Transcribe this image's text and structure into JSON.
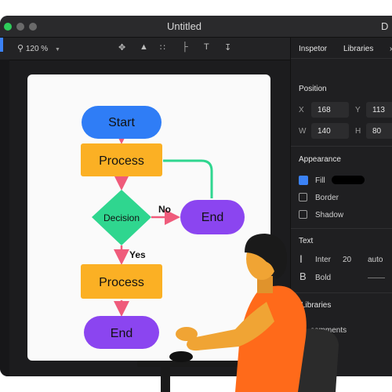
{
  "window": {
    "title": "Untitled"
  },
  "toolbar": {
    "zoom_label": "120 %"
  },
  "inspector": {
    "tabs": [
      {
        "label": "Inspetor"
      },
      {
        "label": "Libraries"
      }
    ],
    "position": {
      "title": "Position",
      "x_label": "X",
      "x_value": "168",
      "y_label": "Y",
      "y_value": "113",
      "w_label": "W",
      "w_value": "140",
      "h_label": "H",
      "h_value": "80"
    },
    "appearance": {
      "title": "Appearance",
      "fill_label": "Fill",
      "fill_color": "#3b82f6",
      "border_label": "Border",
      "shadow_label": "Shadow"
    },
    "text": {
      "title": "Text",
      "font_name": "Inter",
      "font_size": "20",
      "line_height": "auto",
      "weight": "Bold"
    },
    "libraries": {
      "title": "Libraries",
      "comments_label": "comments"
    }
  },
  "flowchart": {
    "start": "Start",
    "process1": "Process",
    "decision": "Decision",
    "end_right": "End",
    "no_label": "No",
    "yes_label": "Yes",
    "process2": "Process",
    "end_bottom": "End"
  },
  "colors": {
    "start_fill": "#2f7df6",
    "process_fill": "#fbb024",
    "decision_fill": "#2fd68f",
    "end_fill": "#8b45f0",
    "arrow": "#ef5b7b",
    "loop_line": "#2fd68f"
  }
}
